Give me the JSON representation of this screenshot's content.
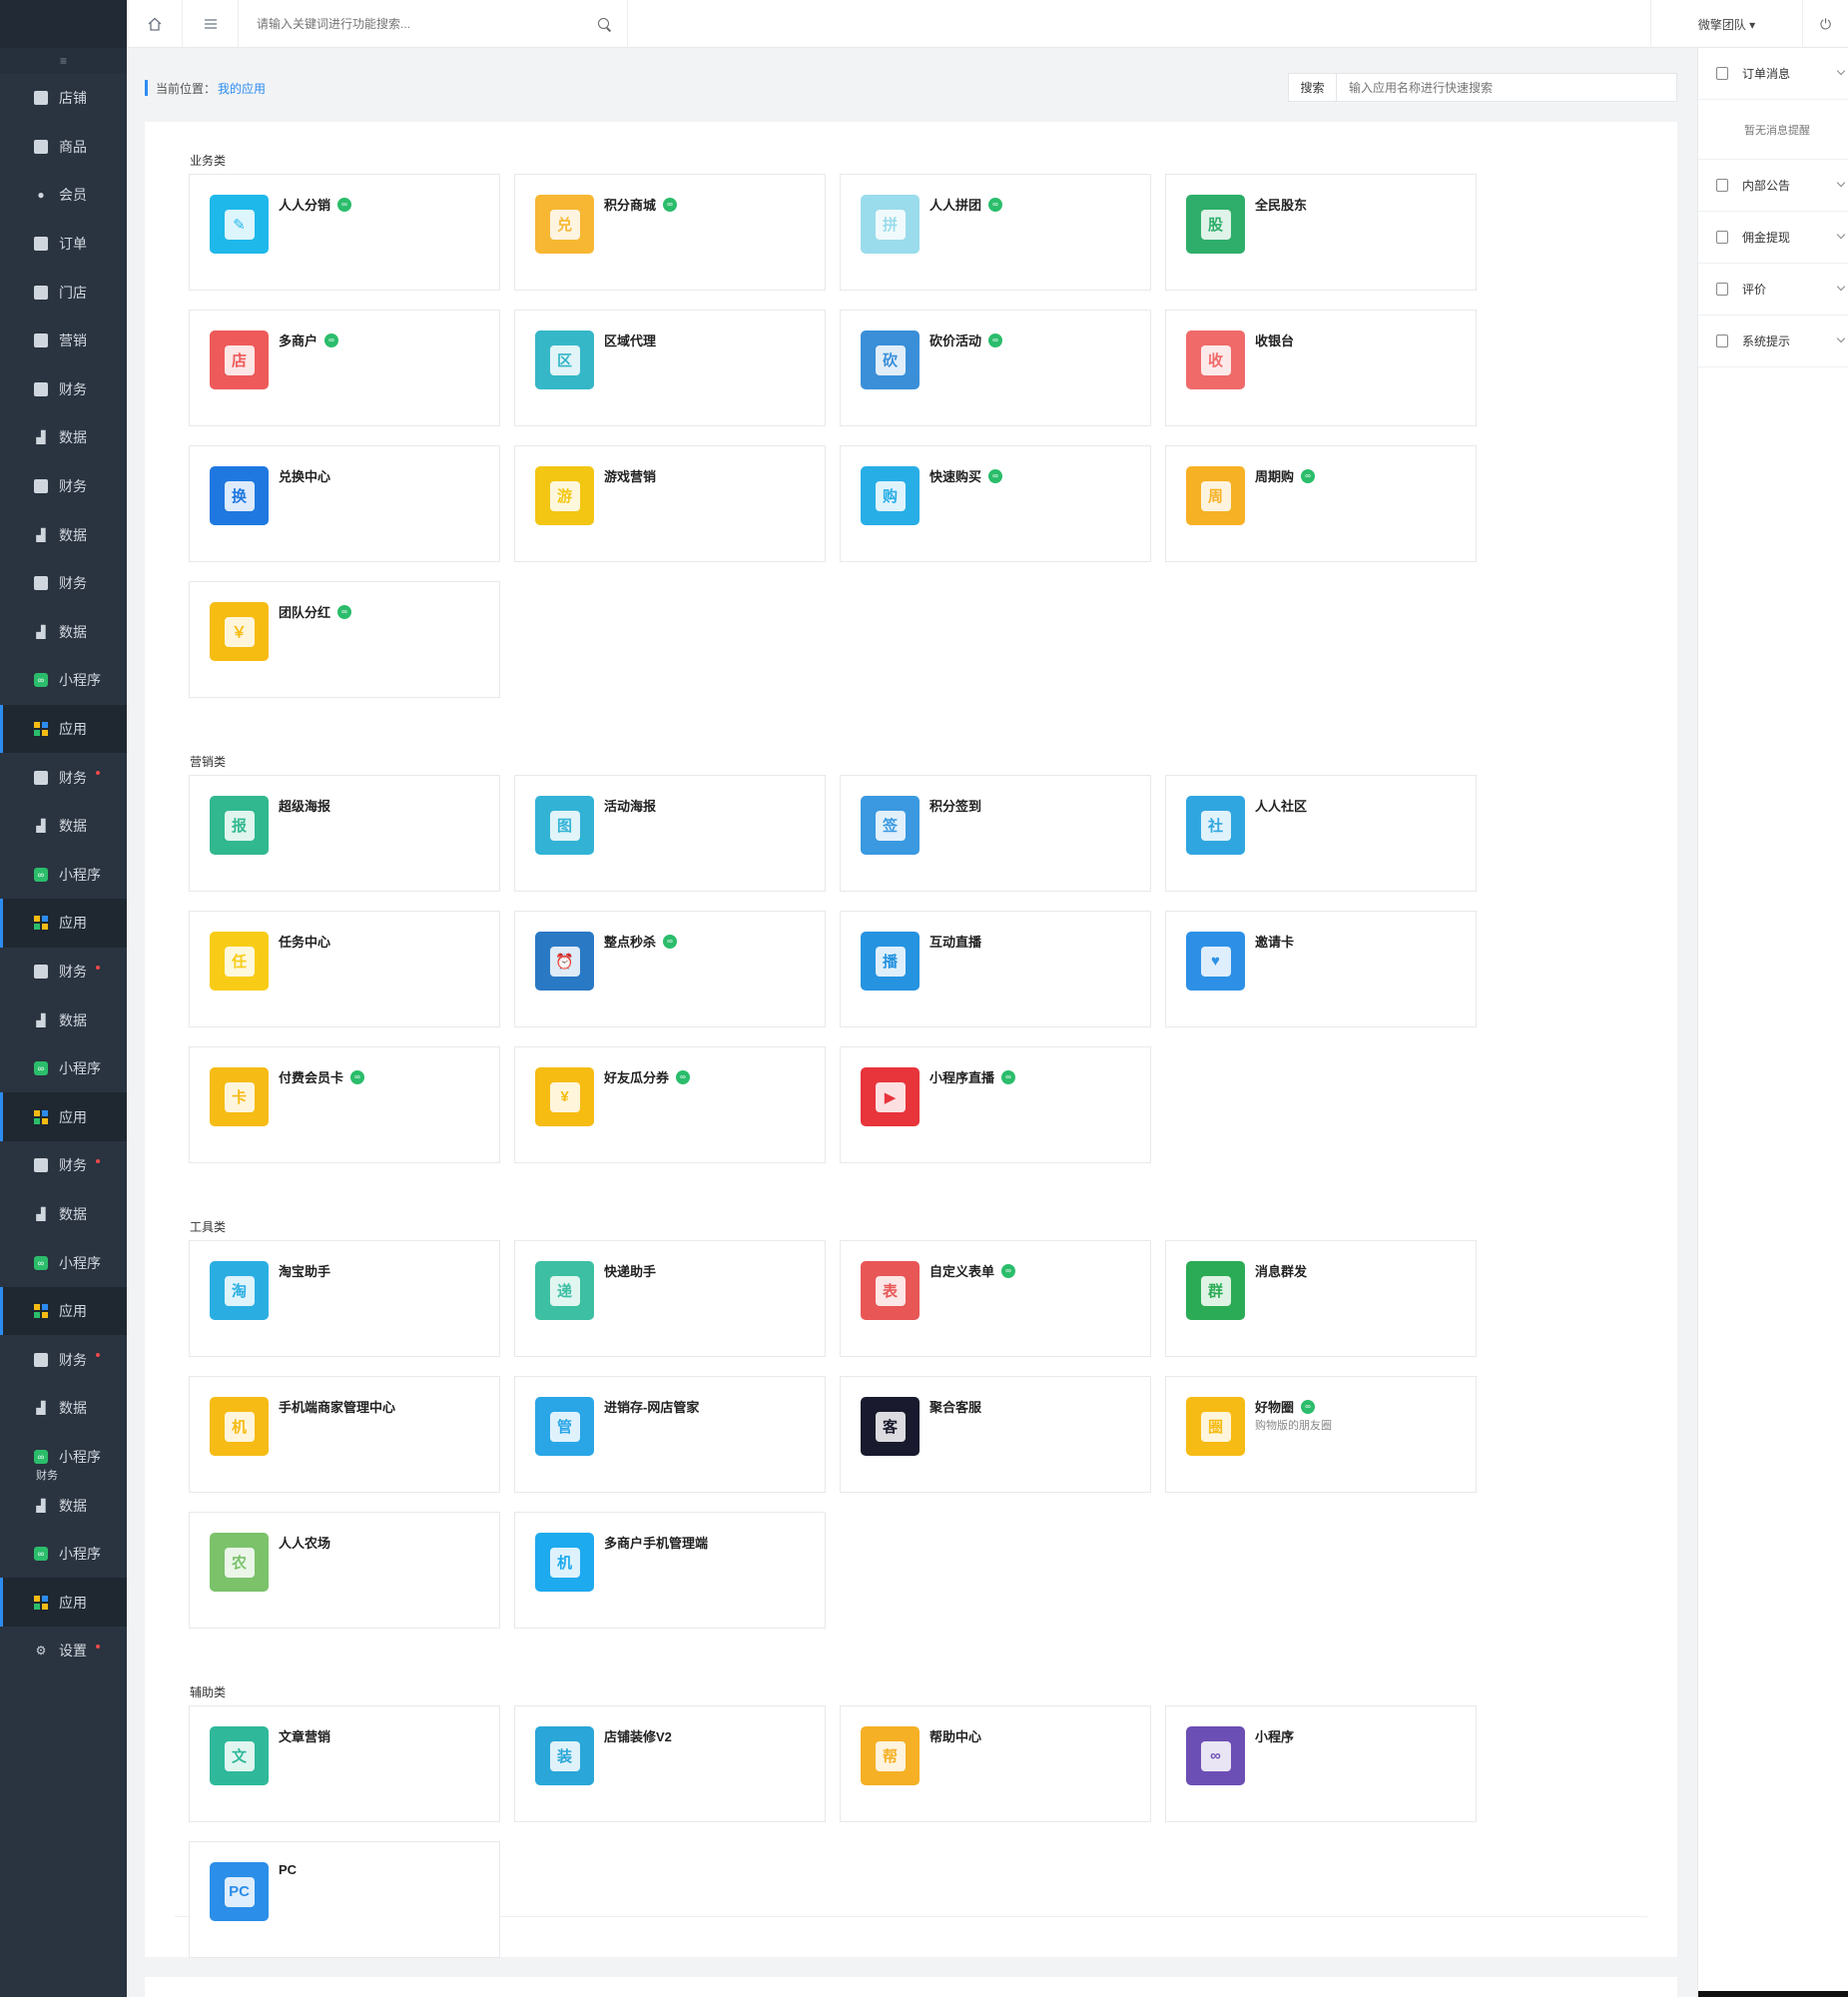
{
  "colors": {
    "sidebar": "#2a3340",
    "accent": "#2d8cf0",
    "badge": "#2bbd6b"
  },
  "sidebar": {
    "toggle_icon": "≡",
    "items": [
      {
        "label": "店铺",
        "icon": "shop-icon"
      },
      {
        "label": "商品",
        "icon": "goods-icon"
      },
      {
        "label": "会员",
        "icon": "member-icon"
      },
      {
        "label": "订单",
        "icon": "order-icon"
      },
      {
        "label": "门店",
        "icon": "store-icon"
      },
      {
        "label": "营销",
        "icon": "marketing-icon"
      },
      {
        "label": "财务",
        "icon": "finance-icon"
      },
      {
        "label": "数据",
        "icon": "data-icon"
      },
      {
        "label": "财务",
        "icon": "finance-icon"
      },
      {
        "label": "数据",
        "icon": "data-icon"
      },
      {
        "label": "财务",
        "icon": "finance-icon"
      },
      {
        "label": "数据",
        "icon": "data-icon"
      },
      {
        "label": "小程序",
        "icon": "miniprogram-icon"
      },
      {
        "label": "应用",
        "icon": "apps-icon",
        "active": true
      },
      {
        "label": "财务",
        "icon": "finance-icon",
        "dot": true
      },
      {
        "label": "数据",
        "icon": "data-icon"
      },
      {
        "label": "小程序",
        "icon": "miniprogram-icon"
      },
      {
        "label": "应用",
        "icon": "apps-icon",
        "active": true
      },
      {
        "label": "财务",
        "icon": "finance-icon",
        "dot": true
      },
      {
        "label": "数据",
        "icon": "data-icon"
      },
      {
        "label": "小程序",
        "icon": "miniprogram-icon"
      },
      {
        "label": "应用",
        "icon": "apps-icon",
        "active": true
      },
      {
        "label": "财务",
        "icon": "finance-icon",
        "dot": true
      },
      {
        "label": "数据",
        "icon": "data-icon"
      },
      {
        "label": "小程序",
        "icon": "miniprogram-icon"
      },
      {
        "label": "应用",
        "icon": "apps-icon",
        "active": true
      },
      {
        "label": "财务",
        "icon": "finance-icon",
        "dot": true
      },
      {
        "label": "数据",
        "icon": "data-icon"
      },
      {
        "label": "小程序",
        "icon": "miniprogram-icon",
        "sub": "财务"
      },
      {
        "label": "数据",
        "icon": "data-icon"
      },
      {
        "label": "小程序",
        "icon": "miniprogram-icon"
      },
      {
        "label": "应用",
        "icon": "apps-icon",
        "active": true
      },
      {
        "label": "设置",
        "icon": "settings-icon",
        "dot": true
      }
    ]
  },
  "topbar": {
    "search_placeholder": "请输入关键词进行功能搜索...",
    "user": "微擎团队 ▾",
    "power_icon": "⏻"
  },
  "breadcrumb": {
    "prefix": "当前位置：",
    "current": "我的应用"
  },
  "app_search": {
    "button": "搜索",
    "placeholder": "输入应用名称进行快速搜索"
  },
  "sections": [
    {
      "title": "业务类",
      "apps": [
        {
          "name": "人人分销",
          "badge": true,
          "color": "#1fb8ea",
          "glyph": "✎"
        },
        {
          "name": "积分商城",
          "badge": true,
          "color": "#f7b733",
          "glyph": "兑"
        },
        {
          "name": "人人拼团",
          "badge": true,
          "color": "#9adcec",
          "glyph": "拼"
        },
        {
          "name": "全民股东",
          "badge": false,
          "color": "#2eae6a",
          "glyph": "股"
        },
        {
          "name": "多商户",
          "badge": true,
          "color": "#ee5a5a",
          "glyph": "店"
        },
        {
          "name": "区域代理",
          "badge": false,
          "color": "#35b7c8",
          "glyph": "区"
        },
        {
          "name": "砍价活动",
          "badge": true,
          "color": "#3a8fd8",
          "glyph": "砍"
        },
        {
          "name": "收银台",
          "badge": false,
          "color": "#f06a6a",
          "glyph": "收"
        },
        {
          "name": "兑换中心",
          "badge": false,
          "color": "#1f78e0",
          "glyph": "换"
        },
        {
          "name": "游戏营销",
          "badge": false,
          "color": "#f3c613",
          "glyph": "游"
        },
        {
          "name": "快速购买",
          "badge": true,
          "color": "#28aee6",
          "glyph": "购"
        },
        {
          "name": "周期购",
          "badge": true,
          "color": "#f7b125",
          "glyph": "周"
        },
        {
          "name": "团队分红",
          "badge": true,
          "color": "#f6bc12",
          "glyph": "￥"
        }
      ]
    },
    {
      "title": "营销类",
      "apps": [
        {
          "name": "超级海报",
          "badge": false,
          "color": "#31b88f",
          "glyph": "报"
        },
        {
          "name": "活动海报",
          "badge": false,
          "color": "#32b3d6",
          "glyph": "图"
        },
        {
          "name": "积分签到",
          "badge": false,
          "color": "#3a99e0",
          "glyph": "签"
        },
        {
          "name": "人人社区",
          "badge": false,
          "color": "#30a6e0",
          "glyph": "社"
        },
        {
          "name": "任务中心",
          "badge": false,
          "color": "#f8cc16",
          "glyph": "任"
        },
        {
          "name": "整点秒杀",
          "badge": true,
          "color": "#2a79c5",
          "glyph": "⏰"
        },
        {
          "name": "互动直播",
          "badge": false,
          "color": "#2593e0",
          "glyph": "播"
        },
        {
          "name": "邀请卡",
          "badge": false,
          "color": "#2d90e6",
          "glyph": "♥"
        },
        {
          "name": "付费会员卡",
          "badge": true,
          "color": "#f6bb14",
          "glyph": "卡"
        },
        {
          "name": "好友瓜分券",
          "badge": true,
          "color": "#f6bc12",
          "glyph": "¥"
        },
        {
          "name": "小程序直播",
          "badge": true,
          "color": "#e8343b",
          "glyph": "▶"
        }
      ]
    },
    {
      "title": "工具类",
      "apps": [
        {
          "name": "淘宝助手",
          "badge": false,
          "color": "#2aaee2",
          "glyph": "淘"
        },
        {
          "name": "快递助手",
          "badge": false,
          "color": "#3cbfa2",
          "glyph": "递"
        },
        {
          "name": "自定义表单",
          "badge": true,
          "color": "#e85656",
          "glyph": "表"
        },
        {
          "name": "消息群发",
          "badge": false,
          "color": "#2bab55",
          "glyph": "群"
        },
        {
          "name": "手机端商家管理中心",
          "badge": false,
          "color": "#f6bb14",
          "glyph": "机"
        },
        {
          "name": "进销存-网店管家",
          "badge": false,
          "color": "#2aa6e6",
          "glyph": "管"
        },
        {
          "name": "聚合客服",
          "badge": false,
          "color": "#1a1a2e",
          "glyph": "客"
        },
        {
          "name": "好物圈",
          "badge": true,
          "color": "#f6bb14",
          "glyph": "圈",
          "desc": "购物版的朋友圈"
        },
        {
          "name": "人人农场",
          "badge": false,
          "color": "#7bc26a",
          "glyph": "农"
        },
        {
          "name": "多商户手机管理端",
          "badge": false,
          "color": "#1eaaee",
          "glyph": "机"
        }
      ]
    },
    {
      "title": "辅助类",
      "apps": [
        {
          "name": "文章营销",
          "badge": false,
          "color": "#2fb89a",
          "glyph": "文"
        },
        {
          "name": "店铺装修V2",
          "badge": false,
          "color": "#2aa6d8",
          "glyph": "装"
        },
        {
          "name": "帮助中心",
          "badge": false,
          "color": "#f5b025",
          "glyph": "帮"
        },
        {
          "name": "小程序",
          "badge": false,
          "color": "#6c4fb4",
          "glyph": "∞"
        },
        {
          "name": "PC",
          "badge": false,
          "color": "#2b8ee8",
          "glyph": "PC"
        }
      ]
    }
  ],
  "right_panel": {
    "rows": [
      {
        "label": "订单消息",
        "icon": "order-message-icon"
      },
      {
        "label": "内部公告",
        "icon": "announcement-icon"
      },
      {
        "label": "佣金提现",
        "icon": "withdraw-icon"
      },
      {
        "label": "评价",
        "icon": "comment-icon"
      },
      {
        "label": "系统提示",
        "icon": "bell-icon"
      }
    ],
    "empty_text": "暂无消息提醒"
  }
}
